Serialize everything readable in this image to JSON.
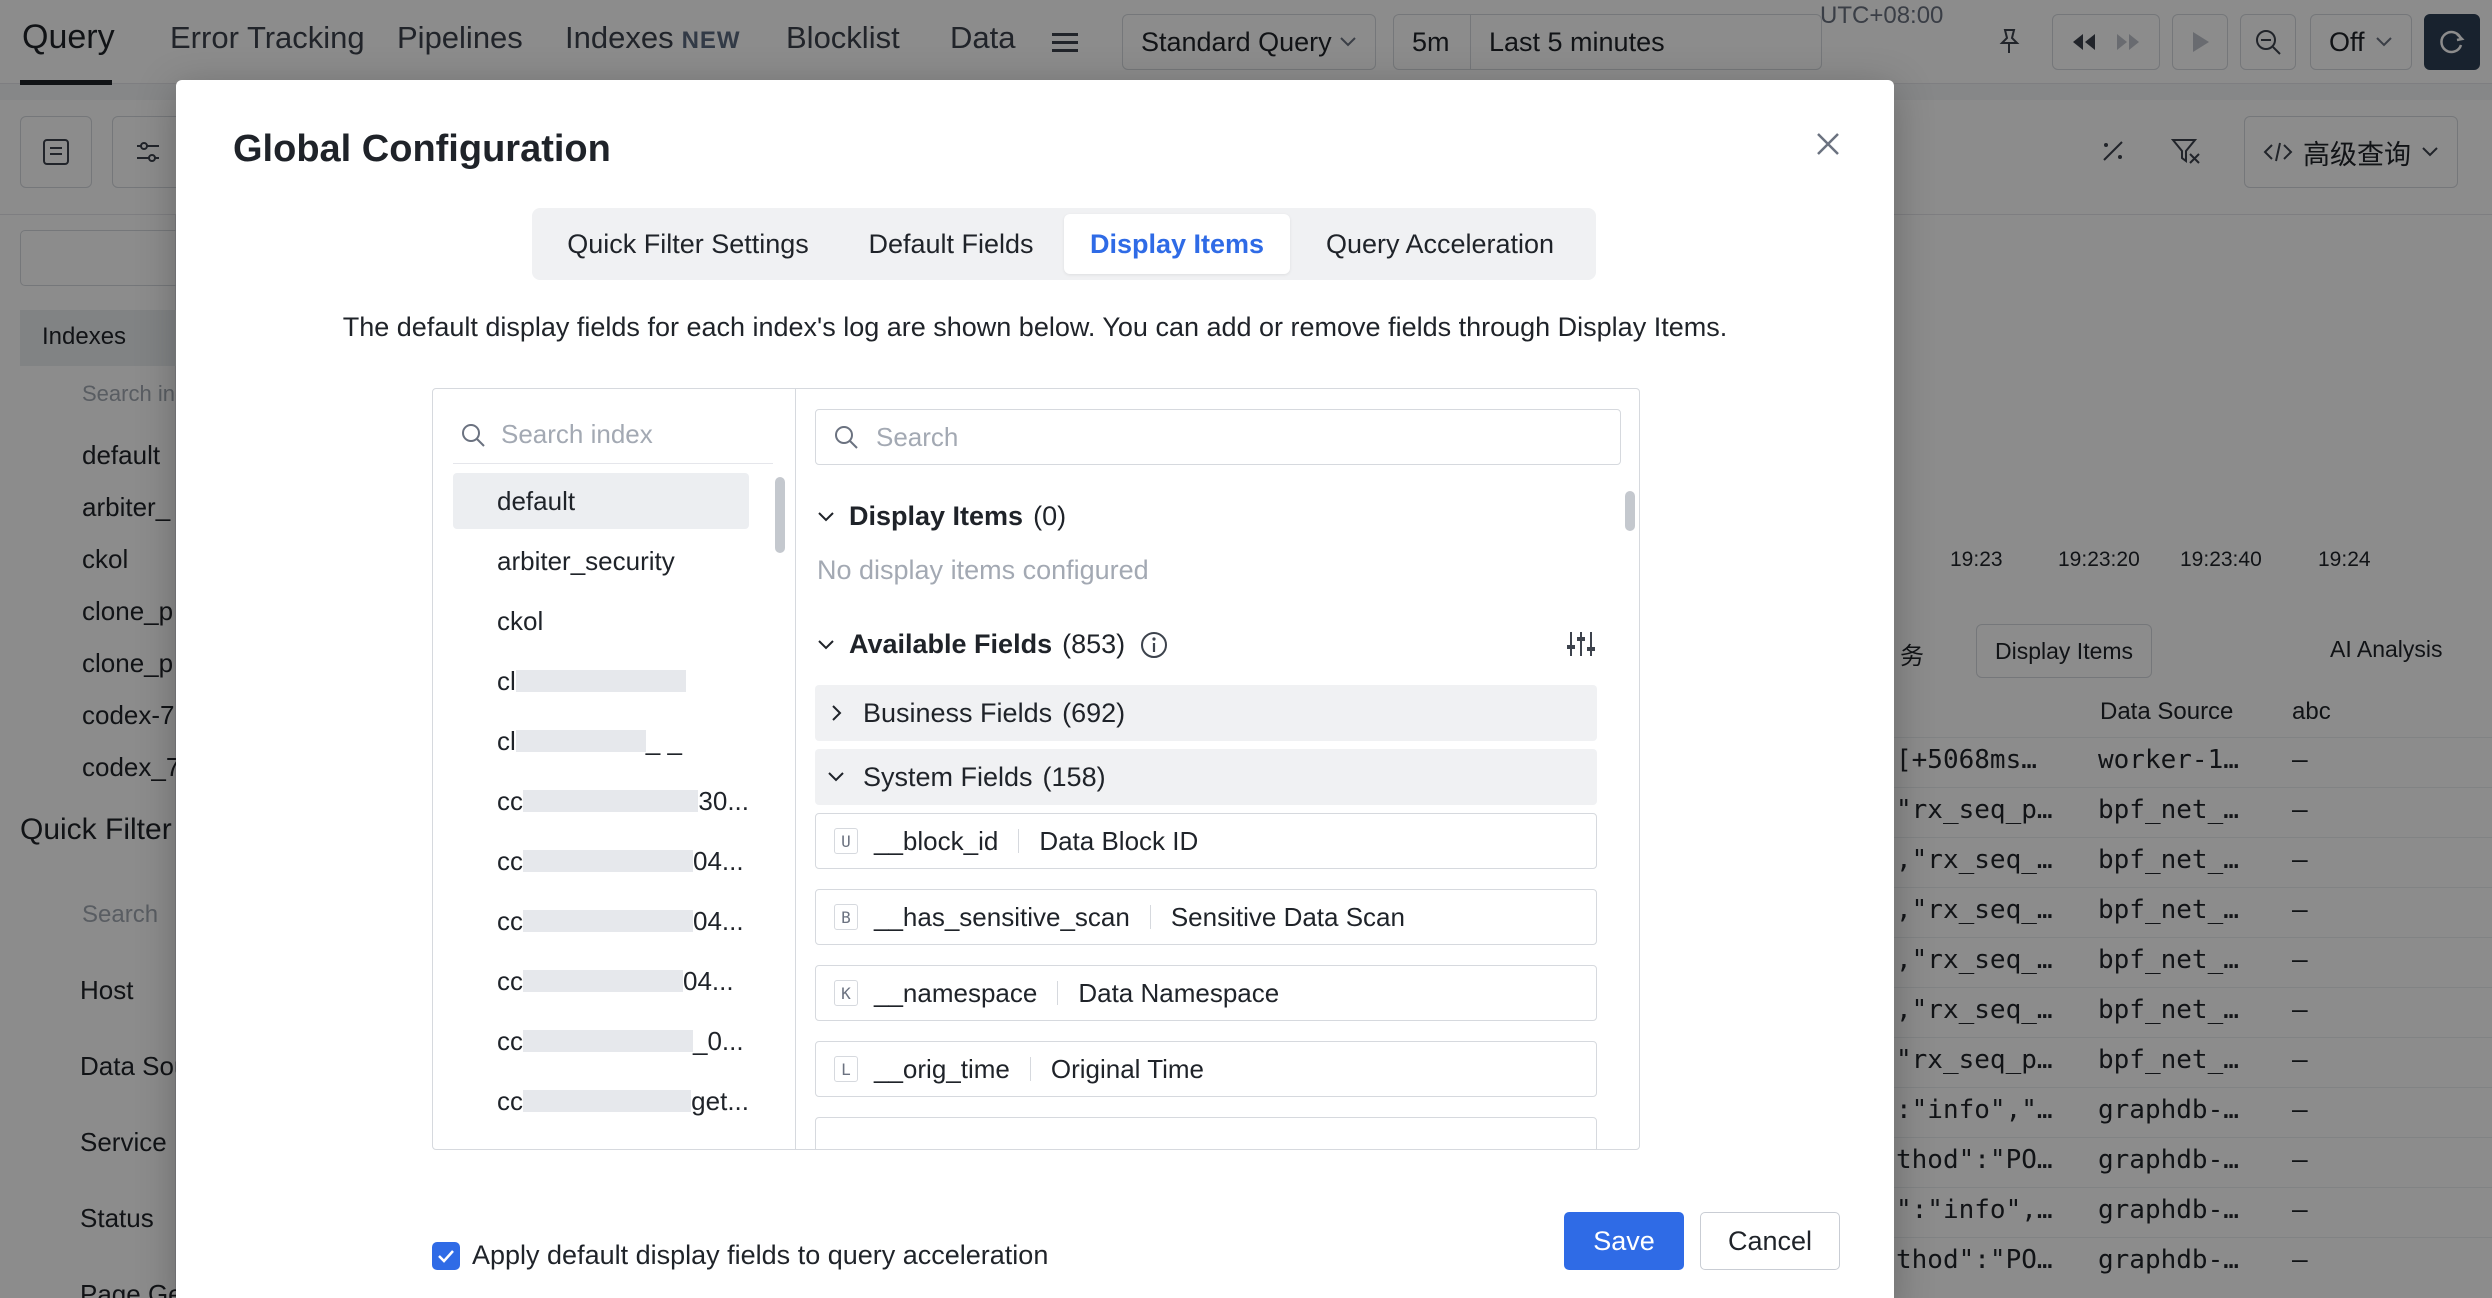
{
  "nav": {
    "tabs": [
      "Query",
      "Error Tracking",
      "Pipelines",
      "Indexes",
      "Blocklist",
      "Data"
    ],
    "new_badge": "NEW",
    "query_mode": "Standard Query",
    "time_short": "5m",
    "time_range": "Last 5 minutes",
    "timezone": "UTC+08:00",
    "refresh": "Off"
  },
  "background": {
    "advanced_query": "高级查询",
    "sidebar": {
      "indexes_label": "Indexes",
      "search_placeholder": "Search inc",
      "index_items": [
        "default",
        "arbiter_",
        "ckol",
        "clone_p",
        "clone_p",
        "codex-7",
        "codex_7"
      ],
      "quick_filter_label": "Quick Filter",
      "quick_search": "Search",
      "filters": [
        "Host",
        "Data Sou",
        "Service",
        "Status",
        "Page Gen"
      ]
    },
    "timeline_labels": [
      "19:23",
      "19:23:20",
      "19:23:40",
      "19:24"
    ],
    "toolbar": {
      "display_items": "Display Items",
      "ai_analysis": "AI Analysis",
      "partial": "务"
    },
    "table": {
      "headers": [
        "Data Source",
        "abc"
      ],
      "rows": [
        [
          "[+5068ms…",
          "worker-1…",
          "–"
        ],
        [
          "\"rx_seq_p…",
          "bpf_net_…",
          "–"
        ],
        [
          ",\"rx_seq_…",
          "bpf_net_…",
          "–"
        ],
        [
          ",\"rx_seq_…",
          "bpf_net_…",
          "–"
        ],
        [
          ",\"rx_seq_…",
          "bpf_net_…",
          "–"
        ],
        [
          ",\"rx_seq_…",
          "bpf_net_…",
          "–"
        ],
        [
          "\"rx_seq_p…",
          "bpf_net_…",
          "–"
        ],
        [
          ":\"info\",\"…",
          "graphdb-…",
          "–"
        ],
        [
          "thod\":\"PO…",
          "graphdb-…",
          "–"
        ],
        [
          "\":\"info\",…",
          "graphdb-…",
          "–"
        ],
        [
          "thod\":\"PO…",
          "graphdb-…",
          "–"
        ]
      ]
    }
  },
  "modal": {
    "title": "Global Configuration",
    "tabs": [
      "Quick Filter Settings",
      "Default Fields",
      "Display Items",
      "Query Acceleration"
    ],
    "active_tab": "Display Items",
    "description": "The default display fields for each index's log are shown below. You can add or remove fields through Display Items.",
    "index_search_placeholder": "Search index",
    "index_list": [
      {
        "prefix": "default",
        "suffix": ""
      },
      {
        "prefix": "arbiter_security",
        "suffix": ""
      },
      {
        "prefix": "ckol",
        "suffix": ""
      },
      {
        "prefix": "cl",
        "suffix": ""
      },
      {
        "prefix": "cl",
        "suffix": "_ _"
      },
      {
        "prefix": "cc",
        "suffix": "30..."
      },
      {
        "prefix": "cc",
        "suffix": "04..."
      },
      {
        "prefix": "cc",
        "suffix": "04..."
      },
      {
        "prefix": "cc",
        "suffix": "04..."
      },
      {
        "prefix": "cc",
        "suffix": "_0..."
      },
      {
        "prefix": "cc",
        "suffix": "get..."
      }
    ],
    "field_search_placeholder": "Search",
    "display_items_label": "Display Items",
    "display_items_count": "(0)",
    "no_items_text": "No display items configured",
    "available_label": "Available Fields",
    "available_count": "(853)",
    "groups": [
      {
        "label": "Business Fields",
        "count": "(692)"
      },
      {
        "label": "System Fields",
        "count": "(158)"
      }
    ],
    "fields": [
      {
        "type": "U",
        "name": "__block_id",
        "desc": "Data Block ID"
      },
      {
        "type": "B",
        "name": "__has_sensitive_scan",
        "desc": "Sensitive Data Scan"
      },
      {
        "type": "K",
        "name": "__namespace",
        "desc": "Data Namespace"
      },
      {
        "type": "L",
        "name": "__orig_time",
        "desc": "Original Time"
      }
    ],
    "apply_checkbox_label": "Apply default display fields to query acceleration",
    "apply_checked": true,
    "save_label": "Save",
    "cancel_label": "Cancel"
  },
  "colors": {
    "accent": "#2f6be6",
    "text": "#1f2329",
    "muted": "#a3a9b3"
  }
}
